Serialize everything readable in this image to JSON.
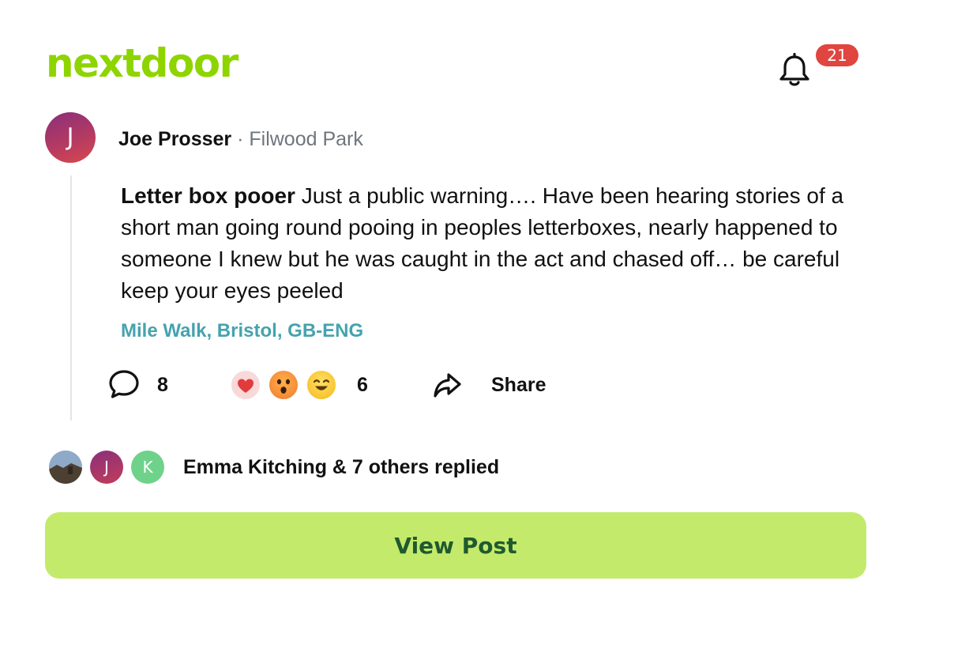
{
  "header": {
    "logo_text": "nextdoor",
    "notifications": {
      "icon": "bell-icon",
      "count": "21"
    }
  },
  "post": {
    "author": {
      "initial": "J",
      "name": "Joe Prosser",
      "separator": "·",
      "neighborhood": "Filwood Park"
    },
    "title": "Letter box pooer",
    "body": "Just a public warning…. Have been hearing stories of a short man going round pooing in peoples letterboxes, nearly happened to someone I knew but he was caught in the act and chased off… be careful keep your eyes peeled",
    "location": "Mile Walk, Bristol, GB-ENG",
    "actions": {
      "comment_icon": "comment-icon",
      "comment_count": "8",
      "reactions": [
        "heart",
        "wow",
        "laugh"
      ],
      "reaction_count": "6",
      "share_icon": "share-icon",
      "share_label": "Share"
    }
  },
  "replies": {
    "avatars": [
      {
        "type": "photo",
        "initial": ""
      },
      {
        "type": "initial",
        "initial": "J"
      },
      {
        "type": "initial",
        "initial": "K"
      }
    ],
    "summary": "Emma Kitching & 7 others replied"
  },
  "view_post_label": "View Post",
  "colors": {
    "brand_green": "#8ED500",
    "badge_red": "#E0453F",
    "location_teal": "#45A3AD",
    "button_bg": "#C4EA6B",
    "button_text": "#1F5A2F"
  }
}
